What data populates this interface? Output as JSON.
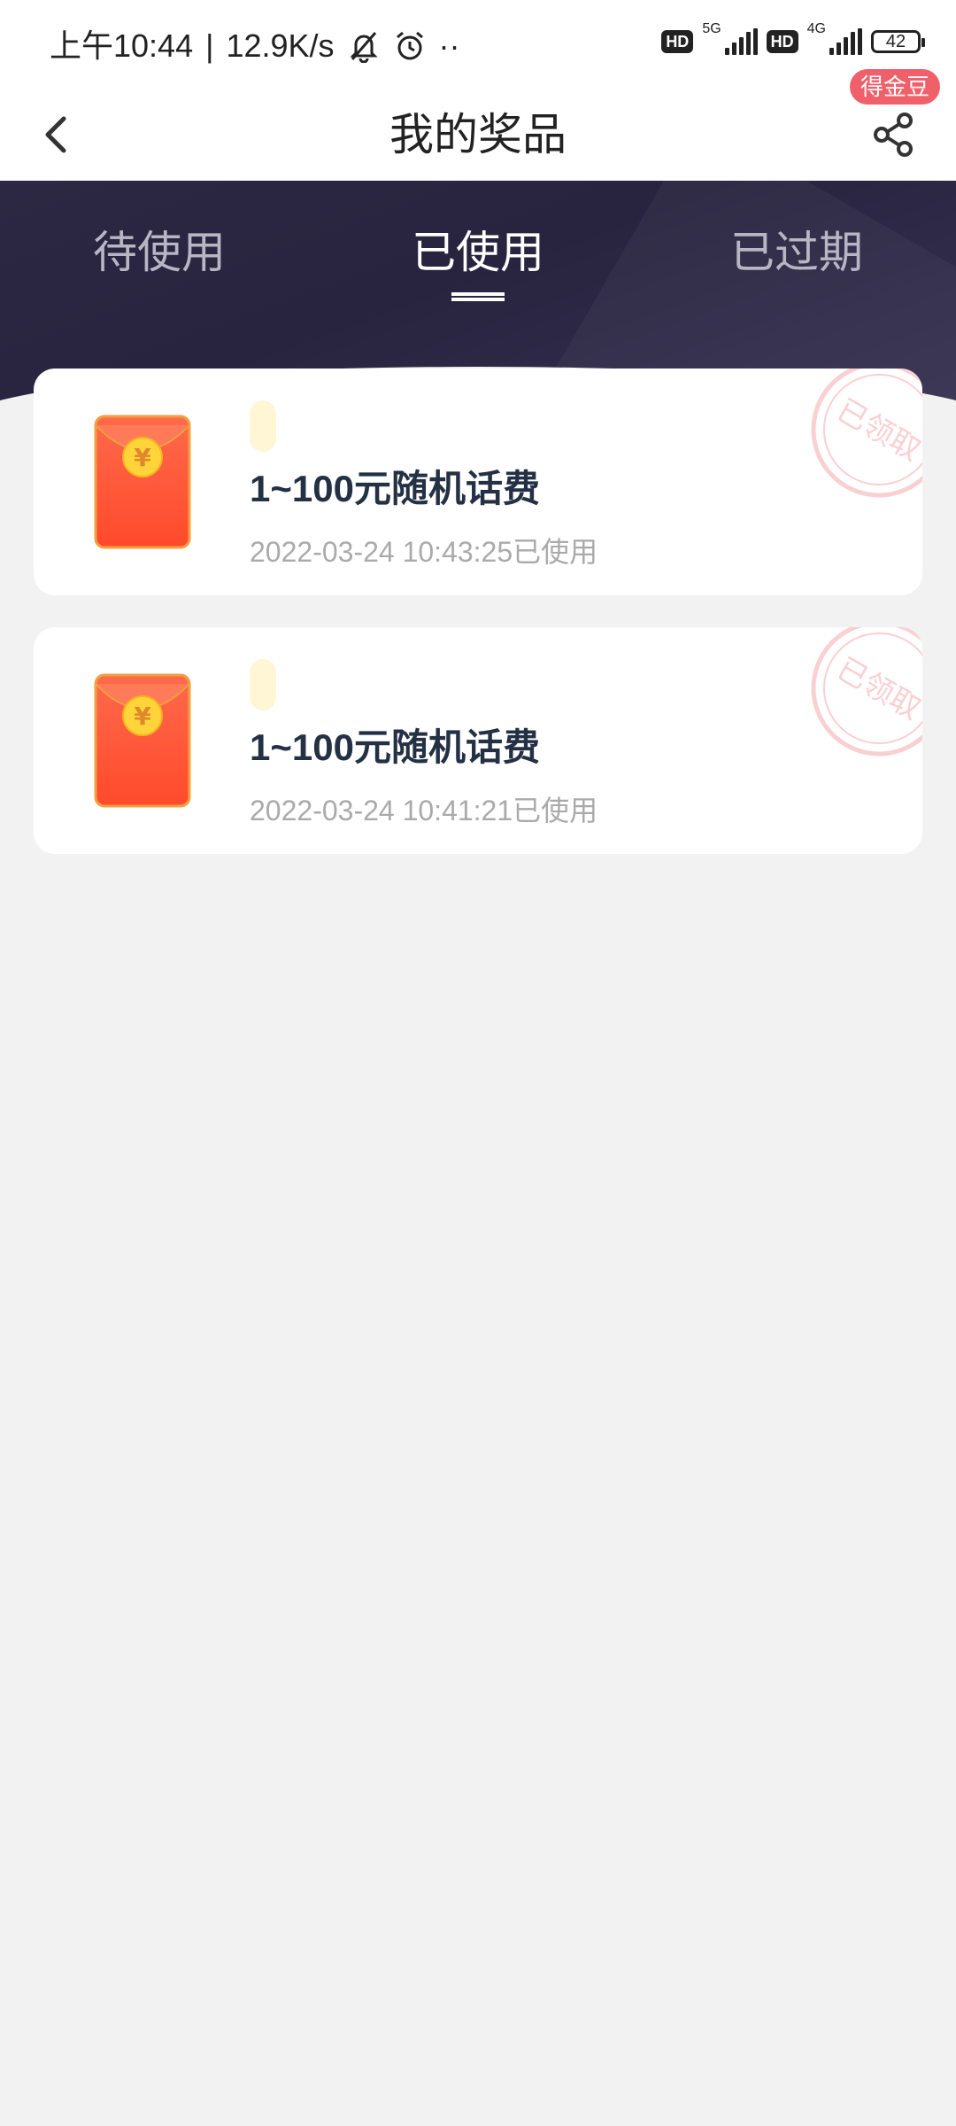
{
  "status_bar": {
    "time": "上午10:44",
    "separator": "|",
    "speed": "12.9K/s",
    "more": "··",
    "hd1": "HD",
    "net1": "5G",
    "hd2": "HD",
    "net2": "4G",
    "battery": "42"
  },
  "nav": {
    "title": "我的奖品",
    "badge": "得金豆"
  },
  "tabs": [
    {
      "label": "待使用"
    },
    {
      "label": "已使用"
    },
    {
      "label": "已过期"
    }
  ],
  "active_tab": "已使用",
  "prizes": [
    {
      "title": "1~100元随机话费",
      "time": "2022-03-24 10:43:25已使用",
      "stamp": "已领取"
    },
    {
      "title": "1~100元随机话费",
      "time": "2022-03-24 10:41:21已使用",
      "stamp": "已领取"
    }
  ],
  "colors": {
    "header_bg": "#2c2843",
    "card_title": "#243044",
    "badge": "#f0606b",
    "envelope": "#ff5a3c"
  }
}
